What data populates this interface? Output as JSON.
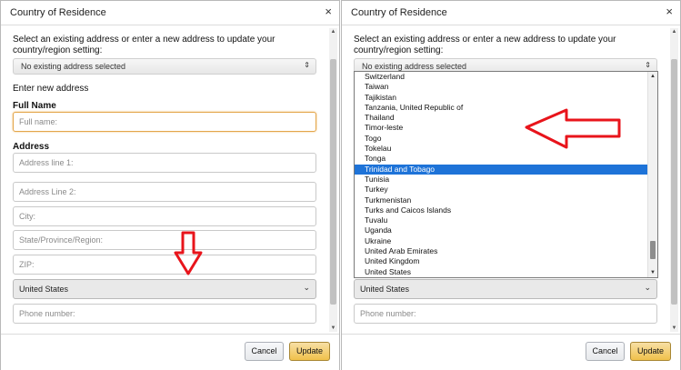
{
  "dialog": {
    "title": "Country of Residence",
    "close_glyph": "×",
    "intro": "Select an existing address or enter a new address to update your country/region setting:",
    "existing_address_value": "No existing address selected",
    "new_address_heading": "Enter new address",
    "full_name_label": "Full Name",
    "full_name_placeholder": "Full name:",
    "address_label": "Address",
    "address_line1_placeholder": "Address line 1:",
    "address_line2_placeholder": "Address Line 2:",
    "city_placeholder": "City:",
    "state_placeholder": "State/Province/Region:",
    "zip_placeholder": "ZIP:",
    "country_value": "United States",
    "phone_placeholder": "Phone number:",
    "cancel_label": "Cancel",
    "update_label": "Update"
  },
  "country_dropdown": {
    "items": [
      "Switzerland",
      "Taiwan",
      "Tajikistan",
      "Tanzania, United Republic of",
      "Thailand",
      "Timor-leste",
      "Togo",
      "Tokelau",
      "Tonga",
      "Trinidad and Tobago",
      "Tunisia",
      "Turkey",
      "Turkmenistan",
      "Turks and Caicos Islands",
      "Tuvalu",
      "Uganda",
      "Ukraine",
      "United Arab Emirates",
      "United Kingdom",
      "United States"
    ],
    "highlighted": "Trinidad and Tobago"
  },
  "annotations": {
    "arrow_color": "#e8141b"
  }
}
